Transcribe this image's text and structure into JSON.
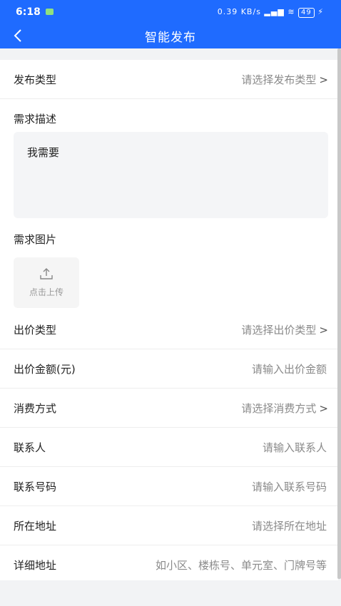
{
  "status_bar": {
    "time": "6:18",
    "net_speed": "0.39 KB/s",
    "battery": "49"
  },
  "header": {
    "title": "智能发布"
  },
  "form": {
    "publish_type": {
      "label": "发布类型",
      "placeholder": "请选择发布类型"
    },
    "description": {
      "label": "需求描述",
      "value": "我需要"
    },
    "images": {
      "label": "需求图片",
      "upload_label": "点击上传"
    },
    "bid_type": {
      "label": "出价类型",
      "placeholder": "请选择出价类型"
    },
    "bid_amount": {
      "label": "出价金额(元)",
      "placeholder": "请输入出价金额"
    },
    "consume_method": {
      "label": "消费方式",
      "placeholder": "请选择消费方式"
    },
    "contact": {
      "label": "联系人",
      "placeholder": "请输入联系人"
    },
    "phone": {
      "label": "联系号码",
      "placeholder": "请输入联系号码"
    },
    "address": {
      "label": "所在地址",
      "placeholder": "请选择所在地址"
    },
    "detail_address": {
      "label": "详细地址",
      "placeholder": "如小区、楼栋号、单元室、门牌号等"
    }
  },
  "icons": {
    "chevron": ">",
    "back": "back-arrow-icon",
    "upload": "upload-icon"
  }
}
